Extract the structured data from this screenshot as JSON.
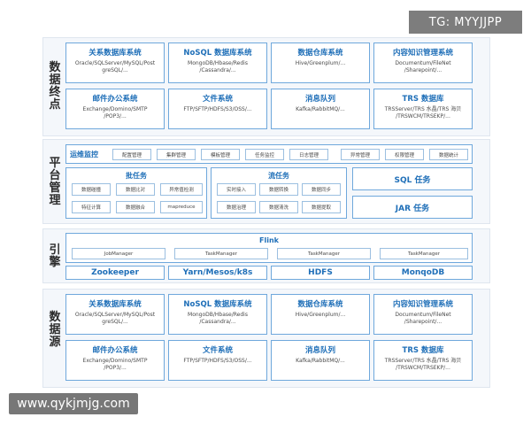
{
  "watermarks": {
    "top": "TG: MYYJJPP",
    "bottom": "www.qykjmjg.com"
  },
  "sections": {
    "terminal": "数据终点",
    "platform": "平台管理",
    "engine": "引擎",
    "source": "数据源"
  },
  "terminal_cards": [
    {
      "title": "关系数据库系统",
      "desc": "Oracle/SQLServer/MySQL/Post\ngreSQL/..."
    },
    {
      "title": "NoSQL 数据库系统",
      "desc": "MongoDB/Hbase/Redis\n/Cassandra/..."
    },
    {
      "title": "数据仓库系统",
      "desc": "Hive/Greenplum/..."
    },
    {
      "title": "内容知识管理系统",
      "desc": "Documentum/FileNet\n/Sharepoint/..."
    },
    {
      "title": "邮件办公系统",
      "desc": "Exchange/Domino/SMTP\n/POP3/..."
    },
    {
      "title": "文件系统",
      "desc": "FTP/SFTP/HDFS/S3/OSS/..."
    },
    {
      "title": "消息队列",
      "desc": "Kafka/RabbitMQ/..."
    },
    {
      "title": "TRS 数据库",
      "desc": "TRSServer/TRS 水晶/TRS 海贝\n/TRSWCM/TRSEKP/..."
    }
  ],
  "platform": {
    "ops_title": "运维监控",
    "ops_items": [
      "配置管理",
      "集群管理",
      "模板管理",
      "任务监控",
      "日志管理",
      "异常管理",
      "权限管理",
      "数据统计"
    ],
    "batch_title": "批任务",
    "batch_items": [
      "数据碰撞",
      "数据比对",
      "异常值检测",
      "特征计算",
      "数据融合",
      "mapreduce"
    ],
    "stream_title": "流任务",
    "stream_items": [
      "实时接入",
      "数据转换",
      "数据同步",
      "数据治理",
      "数据清洗",
      "数据提取"
    ],
    "sql_task": "SQL 任务",
    "jar_task": "JAR 任务"
  },
  "engine": {
    "flink": "Flink",
    "managers": [
      "JobManager",
      "TaskManager",
      "TaskManager",
      "TaskManager"
    ],
    "bottom": [
      "Zookeeper",
      "Yarn/Mesos/k8s",
      "HDFS",
      "MonqoDB"
    ]
  },
  "source_cards": [
    {
      "title": "关系数据库系统",
      "desc": "Oracle/SQLServer/MySQL/Post\ngreSQL/..."
    },
    {
      "title": "NoSQL 数据库系统",
      "desc": "MongoDB/Hbase/Redis\n/Cassandra/..."
    },
    {
      "title": "数据仓库系统",
      "desc": "Hive/Greenplum/..."
    },
    {
      "title": "内容知识管理系统",
      "desc": "Documentum/FileNet\n/Sharepoint/..."
    },
    {
      "title": "邮件办公系统",
      "desc": "Exchange/Domino/SMTP\n/POP3/..."
    },
    {
      "title": "文件系统",
      "desc": "FTP/SFTP/HDFS/S3/OSS/..."
    },
    {
      "title": "消息队列",
      "desc": "Kafka/RabbitMQ/..."
    },
    {
      "title": "TRS 数据库",
      "desc": "TRSServer/TRS 水晶/TRS 海贝\n/TRSWCM/TRSEKP/..."
    }
  ]
}
